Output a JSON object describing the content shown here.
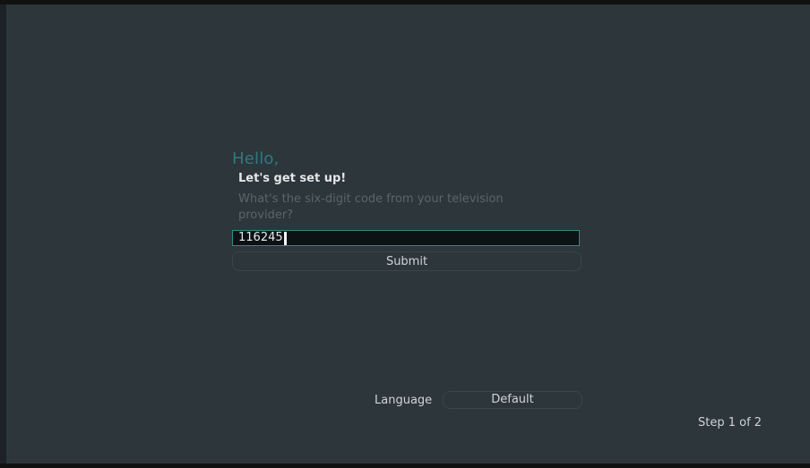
{
  "setup": {
    "greeting": "Hello,",
    "subtitle": "Let's get set up!",
    "prompt": "What's the six-digit code from your television provider?",
    "code_value": "116245",
    "submit_label": "Submit"
  },
  "footer": {
    "language_label": "Language",
    "language_value": "Default",
    "step_text": "Step 1 of 2"
  },
  "colors": {
    "background": "#2c363b",
    "accent": "#2f7a80",
    "input_border": "#2f8c88",
    "input_background": "#0d1215"
  }
}
